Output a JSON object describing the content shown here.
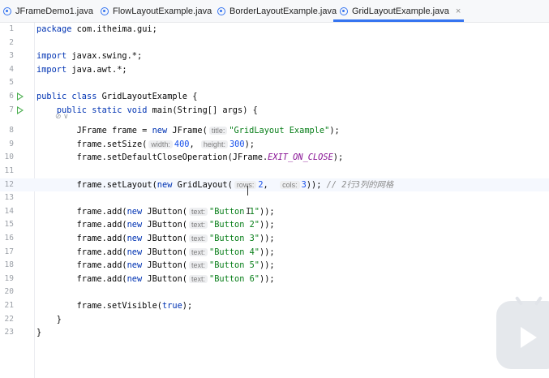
{
  "tabs": [
    {
      "label": "JFrameDemo1.java",
      "active": false
    },
    {
      "label": "FlowLayoutExample.java",
      "active": false
    },
    {
      "label": "BorderLayoutExample.java",
      "active": false
    },
    {
      "label": "GridLayoutExample.java",
      "active": true
    }
  ],
  "tab_close_glyph": "×",
  "annotation_glyph": "⊘ ∨",
  "colors": {
    "accent": "#3574f0",
    "keyword": "#0033b3",
    "string": "#067d17",
    "number": "#1750eb",
    "constant": "#871094",
    "run_icon": "#4caf50"
  },
  "lines": [
    {
      "n": "1",
      "tokens": [
        {
          "t": "kw",
          "v": "package"
        },
        {
          "t": "p",
          "v": " com.itheima.gui;"
        }
      ]
    },
    {
      "n": "2",
      "tokens": []
    },
    {
      "n": "3",
      "tokens": [
        {
          "t": "kw",
          "v": "import"
        },
        {
          "t": "p",
          "v": " javax.swing.*;"
        }
      ]
    },
    {
      "n": "4",
      "tokens": [
        {
          "t": "kw",
          "v": "import"
        },
        {
          "t": "p",
          "v": " java.awt.*;"
        }
      ]
    },
    {
      "n": "5",
      "tokens": []
    },
    {
      "n": "6",
      "run": true,
      "tokens": [
        {
          "t": "kw",
          "v": "public class"
        },
        {
          "t": "p",
          "v": " GridLayoutExample {"
        }
      ]
    },
    {
      "n": "7",
      "run": true,
      "annot": true,
      "tokens": [
        {
          "t": "p",
          "v": "    "
        },
        {
          "t": "kw",
          "v": "public static void"
        },
        {
          "t": "p",
          "v": " main(String[] args) {"
        }
      ]
    },
    {
      "n": "8",
      "tokens": [
        {
          "t": "p",
          "v": "        JFrame frame = "
        },
        {
          "t": "kw",
          "v": "new"
        },
        {
          "t": "p",
          "v": " JFrame("
        },
        {
          "t": "h",
          "v": "title:"
        },
        {
          "t": "str",
          "v": "\"GridLayout Example\""
        },
        {
          "t": "p",
          "v": ");"
        }
      ]
    },
    {
      "n": "9",
      "tokens": [
        {
          "t": "p",
          "v": "        frame.setSize("
        },
        {
          "t": "h",
          "v": "width:"
        },
        {
          "t": "num",
          "v": "400"
        },
        {
          "t": "p",
          "v": ", "
        },
        {
          "t": "h",
          "v": "height:"
        },
        {
          "t": "num",
          "v": "300"
        },
        {
          "t": "p",
          "v": ");"
        }
      ]
    },
    {
      "n": "10",
      "tokens": [
        {
          "t": "p",
          "v": "        frame.setDefaultCloseOperation(JFrame."
        },
        {
          "t": "ital",
          "v": "EXIT_ON_CLOSE"
        },
        {
          "t": "p",
          "v": ");"
        }
      ]
    },
    {
      "n": "11",
      "tokens": []
    },
    {
      "n": "12",
      "current": true,
      "tokens": [
        {
          "t": "p",
          "v": "        frame.setLayout("
        },
        {
          "t": "kw",
          "v": "new"
        },
        {
          "t": "p",
          "v": " GridLayout("
        },
        {
          "t": "h",
          "v": "rows:"
        },
        {
          "t": "num",
          "v": "2"
        },
        {
          "t": "p",
          "v": ",  "
        },
        {
          "t": "h",
          "v": "cols:"
        },
        {
          "t": "num",
          "v": "3"
        },
        {
          "t": "p",
          "v": ")); "
        },
        {
          "t": "cmt",
          "v": "// 2行3列的网格"
        }
      ]
    },
    {
      "n": "13",
      "tokens": []
    },
    {
      "n": "14",
      "tokens": [
        {
          "t": "p",
          "v": "        frame.add("
        },
        {
          "t": "kw",
          "v": "new"
        },
        {
          "t": "p",
          "v": " JButton("
        },
        {
          "t": "h",
          "v": "text:"
        },
        {
          "t": "str",
          "v": "\"Button 1\""
        },
        {
          "t": "p",
          "v": "));"
        }
      ]
    },
    {
      "n": "15",
      "tokens": [
        {
          "t": "p",
          "v": "        frame.add("
        },
        {
          "t": "kw",
          "v": "new"
        },
        {
          "t": "p",
          "v": " JButton("
        },
        {
          "t": "h",
          "v": "text:"
        },
        {
          "t": "str",
          "v": "\"Button 2\""
        },
        {
          "t": "p",
          "v": "));"
        }
      ]
    },
    {
      "n": "16",
      "tokens": [
        {
          "t": "p",
          "v": "        frame.add("
        },
        {
          "t": "kw",
          "v": "new"
        },
        {
          "t": "p",
          "v": " JButton("
        },
        {
          "t": "h",
          "v": "text:"
        },
        {
          "t": "str",
          "v": "\"Button 3\""
        },
        {
          "t": "p",
          "v": "));"
        }
      ]
    },
    {
      "n": "17",
      "tokens": [
        {
          "t": "p",
          "v": "        frame.add("
        },
        {
          "t": "kw",
          "v": "new"
        },
        {
          "t": "p",
          "v": " JButton("
        },
        {
          "t": "h",
          "v": "text:"
        },
        {
          "t": "str",
          "v": "\"Button 4\""
        },
        {
          "t": "p",
          "v": "));"
        }
      ]
    },
    {
      "n": "18",
      "tokens": [
        {
          "t": "p",
          "v": "        frame.add("
        },
        {
          "t": "kw",
          "v": "new"
        },
        {
          "t": "p",
          "v": " JButton("
        },
        {
          "t": "h",
          "v": "text:"
        },
        {
          "t": "str",
          "v": "\"Button 5\""
        },
        {
          "t": "p",
          "v": "));"
        }
      ]
    },
    {
      "n": "19",
      "tokens": [
        {
          "t": "p",
          "v": "        frame.add("
        },
        {
          "t": "kw",
          "v": "new"
        },
        {
          "t": "p",
          "v": " JButton("
        },
        {
          "t": "h",
          "v": "text:"
        },
        {
          "t": "str",
          "v": "\"Button 6\""
        },
        {
          "t": "p",
          "v": "));"
        }
      ]
    },
    {
      "n": "20",
      "tokens": []
    },
    {
      "n": "21",
      "tokens": [
        {
          "t": "p",
          "v": "        frame.setVisible("
        },
        {
          "t": "kw",
          "v": "true"
        },
        {
          "t": "p",
          "v": ");"
        }
      ]
    },
    {
      "n": "22",
      "tokens": [
        {
          "t": "p",
          "v": "    }"
        }
      ]
    },
    {
      "n": "23",
      "tokens": [
        {
          "t": "p",
          "v": "}"
        }
      ]
    }
  ]
}
